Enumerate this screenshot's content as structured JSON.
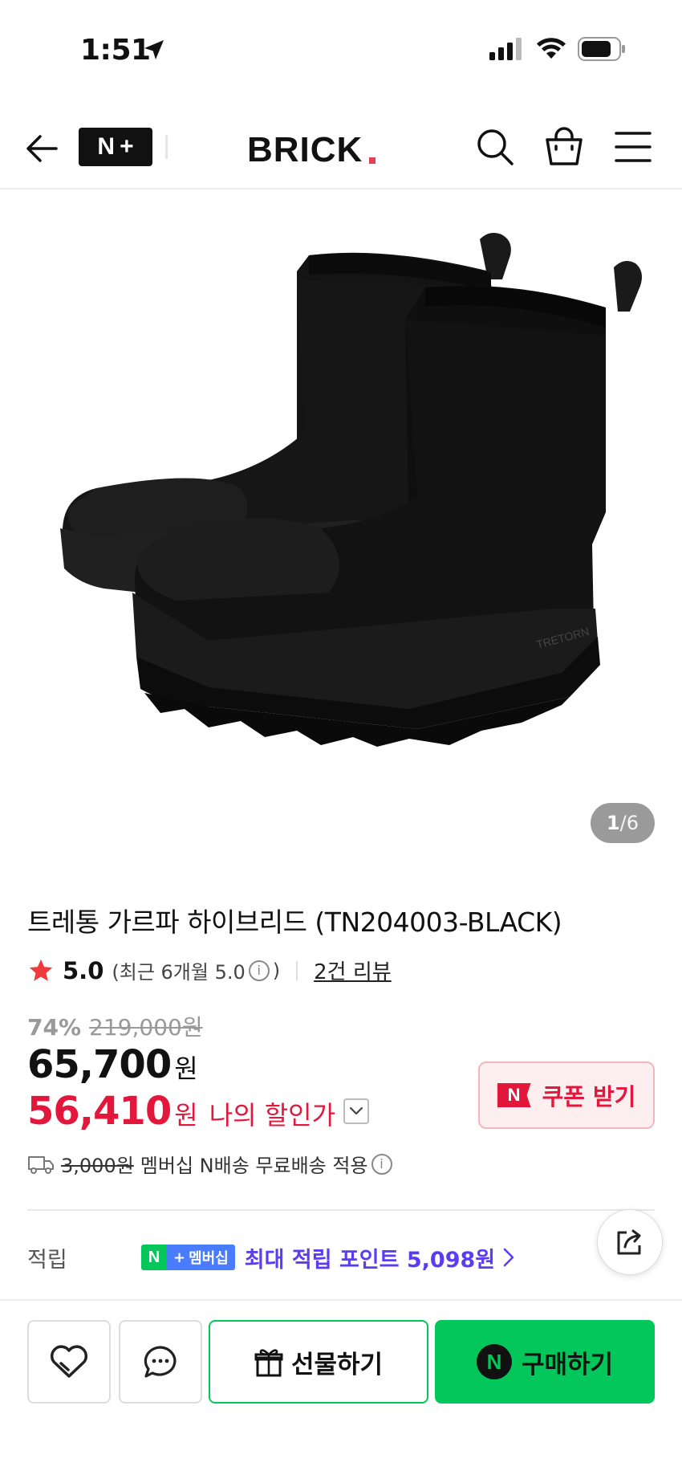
{
  "status_bar": {
    "time": "1:51"
  },
  "header": {
    "nplus_logo_n": "N",
    "nplus_logo_plus": "+",
    "brand_logo": "BRICK"
  },
  "gallery": {
    "current": "1",
    "separator": "/",
    "total": "6"
  },
  "product": {
    "title": "트레통 가르파 하이브리드 (TN204003-BLACK)",
    "rating": "5.0",
    "rating_recent_prefix": "(최근 6개월 5.0",
    "rating_recent_suffix": ")",
    "info_glyph": "i",
    "review_link": "2건 리뷰",
    "discount_rate": "74%",
    "original_price": "219,000원",
    "price": "65,700",
    "price_unit": "원",
    "my_price": "56,410",
    "my_price_unit": "원",
    "my_price_label": "나의 할인가",
    "coupon_n": "N",
    "coupon_label": "쿠폰 받기",
    "shipping_fee": "3,000원",
    "shipping_text": "멤버십 N배송 무료배송 적용",
    "points_label": "적립",
    "membership_n": "N",
    "membership_plus": "+",
    "membership_text": "멤버십",
    "points_text": "최대 적립 포인트 5,098원"
  },
  "actions": {
    "gift_label": "선물하기",
    "buy_n": "N",
    "buy_label": "구매하기"
  },
  "colors": {
    "naver_green": "#03c75a",
    "sale_red": "#e3163c",
    "points_purple": "#5a3cf4",
    "membership_blue": "#4a7cff"
  },
  "icons": [
    "location-arrow-icon",
    "signal-icon",
    "wifi-icon",
    "battery-icon",
    "back-arrow-icon",
    "search-icon",
    "shopping-bag-icon",
    "menu-icon",
    "star-icon",
    "info-icon",
    "chevron-down-icon",
    "truck-icon",
    "chevron-right-icon",
    "share-icon",
    "heart-icon",
    "chat-icon",
    "gift-icon"
  ]
}
